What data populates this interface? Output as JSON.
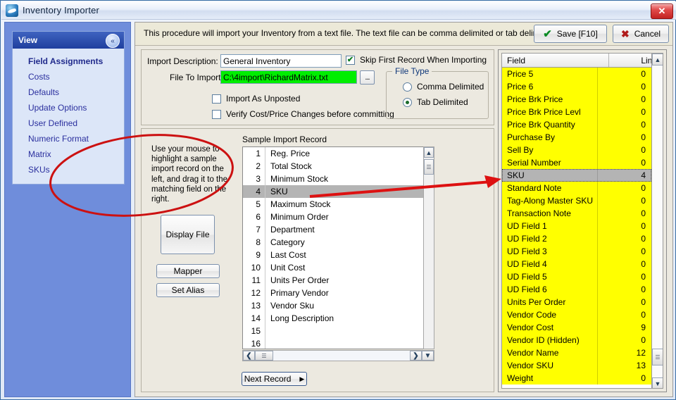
{
  "window": {
    "title": "Inventory Importer",
    "app_icon": "inventory-importer-icon",
    "close_label": "✕"
  },
  "sidebar": {
    "panel_title": "View",
    "collapse_icon": "«",
    "items": [
      {
        "label": "Field Assignments",
        "active": true
      },
      {
        "label": "Costs",
        "active": false
      },
      {
        "label": "Defaults",
        "active": false
      },
      {
        "label": "Update Options",
        "active": false
      },
      {
        "label": "User Defined",
        "active": false
      },
      {
        "label": "Numeric Format",
        "active": false
      },
      {
        "label": "Matrix",
        "active": false
      },
      {
        "label": "SKUs",
        "active": false
      }
    ]
  },
  "header": {
    "description": "This procedure will import your Inventory from a text file.  The text file can be comma delimited or tab delimited.",
    "save_label": "Save [F10]",
    "save_icon": "check-icon",
    "cancel_label": "Cancel",
    "cancel_icon": "x-icon"
  },
  "form": {
    "import_description_label": "Import Description:",
    "import_description_value": "General Inventory",
    "file_to_import_label": "File To Import:",
    "file_to_import_value": "C:\\4import\\RichardMatrix.txt",
    "browse_label": "...",
    "skip_first_record_label": "Skip First Record When Importing",
    "skip_first_record_checked": true,
    "import_as_unposted_label": "Import As Unposted",
    "import_as_unposted_checked": false,
    "verify_cost_label": "Verify Cost/Price Changes before committing",
    "verify_cost_checked": false,
    "check_glyph": "✔",
    "file_type": {
      "title": "File Type",
      "options": [
        {
          "label": "Comma Delimited",
          "selected": false
        },
        {
          "label": "Tab Delimited",
          "selected": true
        }
      ]
    },
    "highlight_color": "#00ee00"
  },
  "lower": {
    "hint": "Use your mouse to highlight a sample import record on the left, and drag it to the matching field on the right.",
    "display_file_label": "Display File",
    "mapper_label": "Mapper",
    "set_alias_label": "Set Alias",
    "next_record_label": "Next Record",
    "next_record_icon": "▶",
    "sample_title": "Sample Import Record",
    "sample_rows": [
      {
        "num": "1",
        "name": "Reg. Price",
        "selected": false
      },
      {
        "num": "2",
        "name": "Total Stock",
        "selected": false
      },
      {
        "num": "3",
        "name": "Minimum Stock",
        "selected": false
      },
      {
        "num": "4",
        "name": "SKU",
        "selected": true
      },
      {
        "num": "5",
        "name": "Maximum Stock",
        "selected": false
      },
      {
        "num": "6",
        "name": "Minimum Order",
        "selected": false
      },
      {
        "num": "7",
        "name": "Department",
        "selected": false
      },
      {
        "num": "8",
        "name": "Category",
        "selected": false
      },
      {
        "num": "9",
        "name": "Last Cost",
        "selected": false
      },
      {
        "num": "10",
        "name": "Unit Cost",
        "selected": false
      },
      {
        "num": "11",
        "name": "Units Per Order",
        "selected": false
      },
      {
        "num": "12",
        "name": "Primary Vendor",
        "selected": false
      },
      {
        "num": "13",
        "name": "Vendor Sku",
        "selected": false
      },
      {
        "num": "14",
        "name": "Long Description",
        "selected": false
      },
      {
        "num": "15",
        "name": "",
        "selected": false
      },
      {
        "num": "16",
        "name": "",
        "selected": false
      }
    ]
  },
  "field_grid": {
    "columns": [
      "Field",
      "Line"
    ],
    "rows": [
      {
        "field": "Price 5",
        "line": "0",
        "selected": false
      },
      {
        "field": "Price 6",
        "line": "0",
        "selected": false
      },
      {
        "field": "Price Brk Price",
        "line": "0",
        "selected": false
      },
      {
        "field": "Price Brk Price Levl",
        "line": "0",
        "selected": false
      },
      {
        "field": "Price Brk Quantity",
        "line": "0",
        "selected": false
      },
      {
        "field": "Purchase By",
        "line": "0",
        "selected": false
      },
      {
        "field": "Sell By",
        "line": "0",
        "selected": false
      },
      {
        "field": "Serial Number",
        "line": "0",
        "selected": false
      },
      {
        "field": "SKU",
        "line": "4",
        "selected": true
      },
      {
        "field": "Standard Note",
        "line": "0",
        "selected": false
      },
      {
        "field": "Tag-Along Master SKU",
        "line": "0",
        "selected": false
      },
      {
        "field": "Transaction Note",
        "line": "0",
        "selected": false
      },
      {
        "field": "UD Field 1",
        "line": "0",
        "selected": false
      },
      {
        "field": "UD Field 2",
        "line": "0",
        "selected": false
      },
      {
        "field": "UD Field 3",
        "line": "0",
        "selected": false
      },
      {
        "field": "UD Field 4",
        "line": "0",
        "selected": false
      },
      {
        "field": "UD Field 5",
        "line": "0",
        "selected": false
      },
      {
        "field": "UD Field 6",
        "line": "0",
        "selected": false
      },
      {
        "field": "Units Per Order",
        "line": "0",
        "selected": false
      },
      {
        "field": "Vendor Code",
        "line": "0",
        "selected": false
      },
      {
        "field": "Vendor Cost",
        "line": "9",
        "selected": false
      },
      {
        "field": "Vendor ID (Hidden)",
        "line": "0",
        "selected": false
      },
      {
        "field": "Vendor Name",
        "line": "12",
        "selected": false
      },
      {
        "field": "Vendor SKU",
        "line": "13",
        "selected": false
      },
      {
        "field": "Weight",
        "line": "0",
        "selected": false
      }
    ],
    "row_background": "#ffff00"
  },
  "annotations": {
    "ellipse_color": "#cc1111",
    "arrow_color": "#dd1111"
  }
}
